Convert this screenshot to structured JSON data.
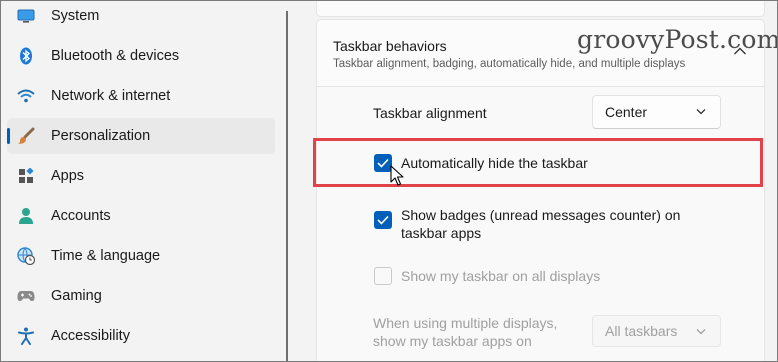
{
  "sidebar": {
    "items": [
      {
        "label": "System",
        "icon": "monitor-icon",
        "active": false
      },
      {
        "label": "Bluetooth & devices",
        "icon": "bluetooth-icon",
        "active": false
      },
      {
        "label": "Network & internet",
        "icon": "wifi-icon",
        "active": false
      },
      {
        "label": "Personalization",
        "icon": "paintbrush-icon",
        "active": true
      },
      {
        "label": "Apps",
        "icon": "apps-icon",
        "active": false
      },
      {
        "label": "Accounts",
        "icon": "person-icon",
        "active": false
      },
      {
        "label": "Time & language",
        "icon": "globe-clock-icon",
        "active": false
      },
      {
        "label": "Gaming",
        "icon": "gamepad-icon",
        "active": false
      },
      {
        "label": "Accessibility",
        "icon": "accessibility-icon",
        "active": false
      }
    ]
  },
  "watermark": "groovyPost.com",
  "section": {
    "title": "Taskbar behaviors",
    "subtitle": "Taskbar alignment, badging, automatically hide, and multiple displays",
    "expanded": true
  },
  "settings": {
    "alignment_label": "Taskbar alignment",
    "alignment_value": "Center",
    "auto_hide": {
      "label": "Automatically hide the taskbar",
      "checked": true
    },
    "badges": {
      "label_line1": "Show badges (unread messages counter) on",
      "label_line2": "taskbar apps",
      "checked": true
    },
    "all_displays": {
      "label": "Show my taskbar on all displays",
      "checked": false,
      "enabled": false
    },
    "multi_display_label_line1": "When using multiple displays,",
    "multi_display_label_line2": "show my taskbar apps on",
    "multi_display_value": "All taskbars"
  },
  "colors": {
    "accent": "#005fb8",
    "highlight": "#e0444a"
  }
}
